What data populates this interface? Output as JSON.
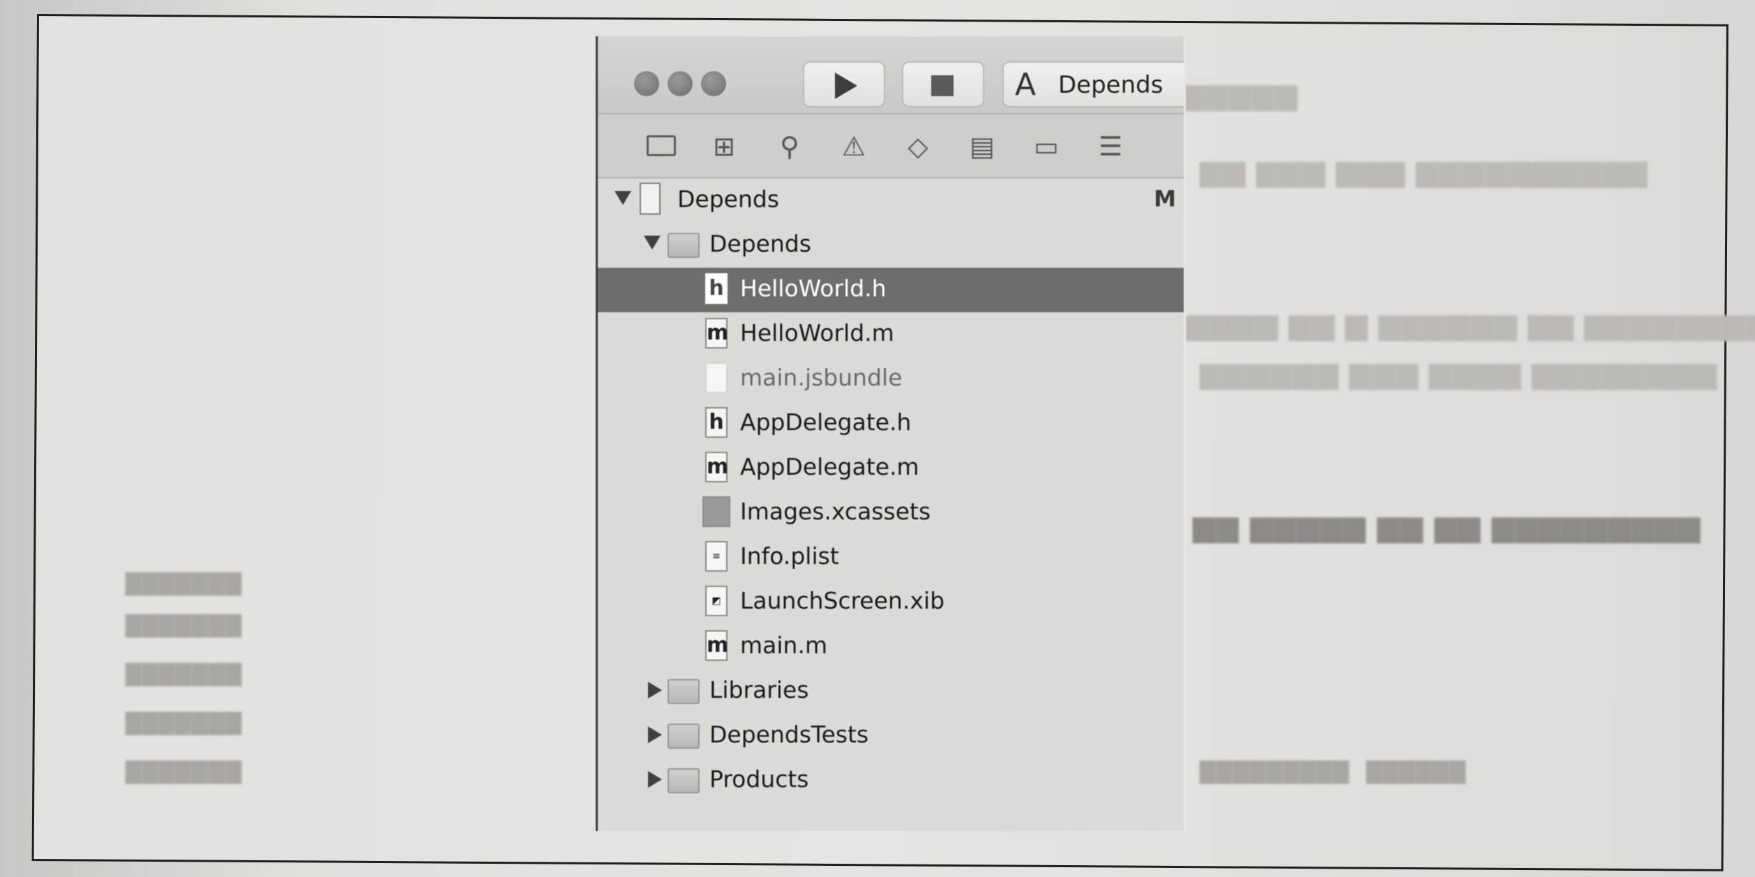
{
  "toolbar": {
    "scheme_label": "Depends",
    "run_label": "",
    "stop_label": ""
  },
  "navigator": {
    "icons": [
      "folder-icon",
      "hierarchy-icon",
      "search-icon",
      "warning-icon",
      "test-icon",
      "debug-icon",
      "breakpoint-icon",
      "report-icon"
    ]
  },
  "tree": {
    "project": {
      "label": "Depends",
      "badge": "M"
    },
    "group": {
      "label": "Depends"
    },
    "files": [
      {
        "label": "HelloWorld.h",
        "type": "h",
        "selected": true
      },
      {
        "label": "HelloWorld.m",
        "type": "m"
      },
      {
        "label": "main.jsbundle",
        "type": "blank"
      },
      {
        "label": "AppDelegate.h",
        "type": "h"
      },
      {
        "label": "AppDelegate.m",
        "type": "m"
      },
      {
        "label": "Images.xcassets",
        "type": "assets"
      },
      {
        "label": "Info.plist",
        "type": "plist"
      },
      {
        "label": "LaunchScreen.xib",
        "type": "xib"
      },
      {
        "label": "main.m",
        "type": "m"
      }
    ],
    "groups_collapsed": [
      {
        "label": "Libraries"
      },
      {
        "label": "DependsTests"
      },
      {
        "label": "Products"
      }
    ]
  }
}
